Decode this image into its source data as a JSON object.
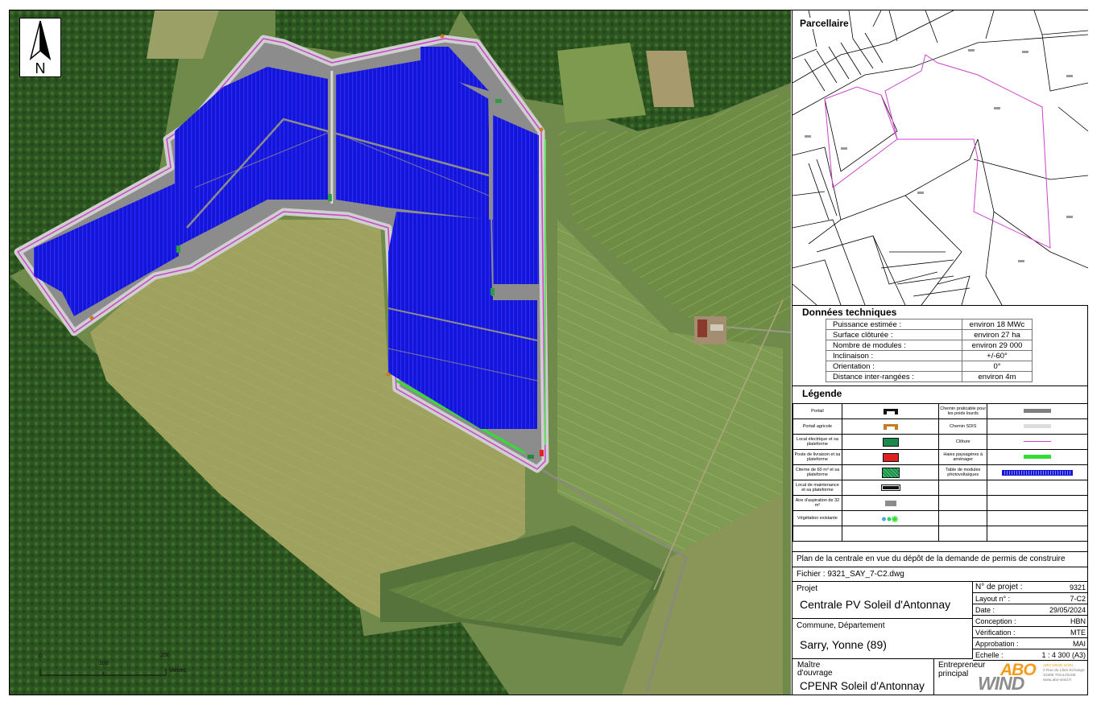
{
  "north_letter": "N",
  "scale_bar": {
    "ticks": [
      "0",
      "100",
      "200"
    ],
    "unit": "Mètres"
  },
  "parcellaire_title": "Parcellaire",
  "donnees_techniques": {
    "title": "Données techniques",
    "rows": [
      {
        "label": "Puissance estimée :",
        "value": "environ 18 MWc"
      },
      {
        "label": "Surface clôturée :",
        "value": "environ 27 ha"
      },
      {
        "label": "Nombre de modules :",
        "value": "environ 29 000"
      },
      {
        "label": "Inclinaison :",
        "value": "+/-60°"
      },
      {
        "label": "Orientation :",
        "value": "0°"
      },
      {
        "label": "Distance inter-rangées :",
        "value": "environ 4m"
      }
    ]
  },
  "legende": {
    "title": "Légende",
    "left": [
      "Portail",
      "Portail agricole",
      "Local électrique et sa plateforme",
      "Poste de livraison et sa plateforme",
      "Citerne de 60 m³ et sa plateforme",
      "Local de maintenance et sa plateforme",
      "Aire d'aspiration de 32 m²",
      "Végétation existante"
    ],
    "right": [
      "Chemin praticable pour les poids lourds",
      "Chemin SDIS",
      "Clôture",
      "Haies paysagères à aménager",
      "Table de modules photovoltaïques"
    ]
  },
  "description": "Plan de la centrale en vue du dépôt de la demande de permis de construire",
  "fichier": "Fichier : 9321_SAY_7-C2.dwg",
  "projet": {
    "label": "Projet",
    "value": "Centrale PV Soleil d'Antonnay"
  },
  "commune": {
    "label": "Commune, Département",
    "value": "Sarry, Yonne (89)"
  },
  "meta": [
    {
      "label": "N° de projet :",
      "value": "9321"
    },
    {
      "label": "Layout n° :",
      "value": "7-C2"
    },
    {
      "label": "Date :",
      "value": "29/05/2024"
    },
    {
      "label": "Conception :",
      "value": "HBN"
    },
    {
      "label": "Vérification :",
      "value": "MTE"
    },
    {
      "label": "Approbation :",
      "value": "MAI"
    },
    {
      "label": "Echelle :",
      "value": "1 : 4 300 (A3)"
    }
  ],
  "maitre": {
    "label": "Maître d'ouvrage",
    "value": "CPENR Soleil d'Antonnay"
  },
  "entrepreneur": {
    "label": "Entrepreneur principal",
    "logo_top": "ABO",
    "logo_bottom": "WIND",
    "address": [
      "ABO WIND SARL",
      "2 Rue du Libre Echange",
      "31506 TOULOUSE",
      "www.abo-wind.fr"
    ]
  },
  "colors": {
    "modules": "#1515d6",
    "cloture": "#cc44cc",
    "chemin_pl": "#7f7f7f",
    "chemin_sdis": "#dcdcdc",
    "haies": "#33dd33",
    "forest": "#2f5a20",
    "field": "#8aa45c",
    "meadow": "#a9a868"
  }
}
